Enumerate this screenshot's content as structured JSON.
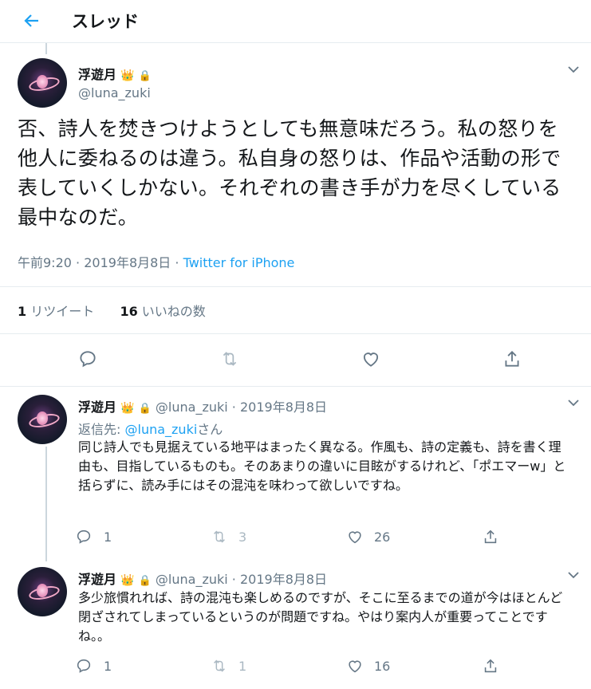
{
  "header": {
    "title": "スレッド"
  },
  "main_tweet": {
    "display_name": "浮遊月",
    "handle": "@luna_zuki",
    "text": "否、詩人を焚きつけようとしても無意味だろう。私の怒りを他人に委ねるのは違う。私自身の怒りは、作品や活動の形で表していくしかない。それぞれの書き手が力を尽くしている最中なのだ。",
    "time": "午前9:20",
    "date": "2019年8月8日",
    "dot": "·",
    "source": "Twitter for iPhone",
    "retweet_count": "1",
    "retweet_label": "リツイート",
    "like_count": "16",
    "like_label": "いいねの数"
  },
  "replies": [
    {
      "display_name": "浮遊月",
      "handle": "@luna_zuki",
      "date": "· 2019年8月8日",
      "reply_to_label": "返信先:",
      "reply_to_handle": "@luna_zuki",
      "reply_to_suffix": "さん",
      "text": "同じ詩人でも見据えている地平はまったく異なる。作風も、詩の定義も、詩を書く理由も、目指しているものも。そのあまりの違いに目眩がするけれど、「ポエマーw」と括らずに、読み手にはその混沌を味わって欲しいですね。",
      "reply_count": "1",
      "retweet_count": "3",
      "like_count": "26"
    },
    {
      "display_name": "浮遊月",
      "handle": "@luna_zuki",
      "date": "· 2019年8月8日",
      "text": "多少旅慣れれば、詩の混沌も楽しめるのですが、そこに至るまでの道が今はほとんど閉ざされてしまっているというのが問題ですね。やはり案内人が重要ってことですね。。",
      "reply_count": "1",
      "retweet_count": "1",
      "like_count": "16"
    }
  ],
  "icons": {
    "back": "arrow-left-icon",
    "crown": "crown-icon",
    "lock": "lock-icon",
    "chevron": "chevron-down-icon",
    "reply": "reply-icon",
    "retweet": "retweet-icon",
    "like": "heart-icon",
    "share": "share-icon"
  },
  "colors": {
    "accent": "#1da1f2",
    "muted": "#657786",
    "text": "#14171a",
    "border": "#e6ecf0"
  }
}
